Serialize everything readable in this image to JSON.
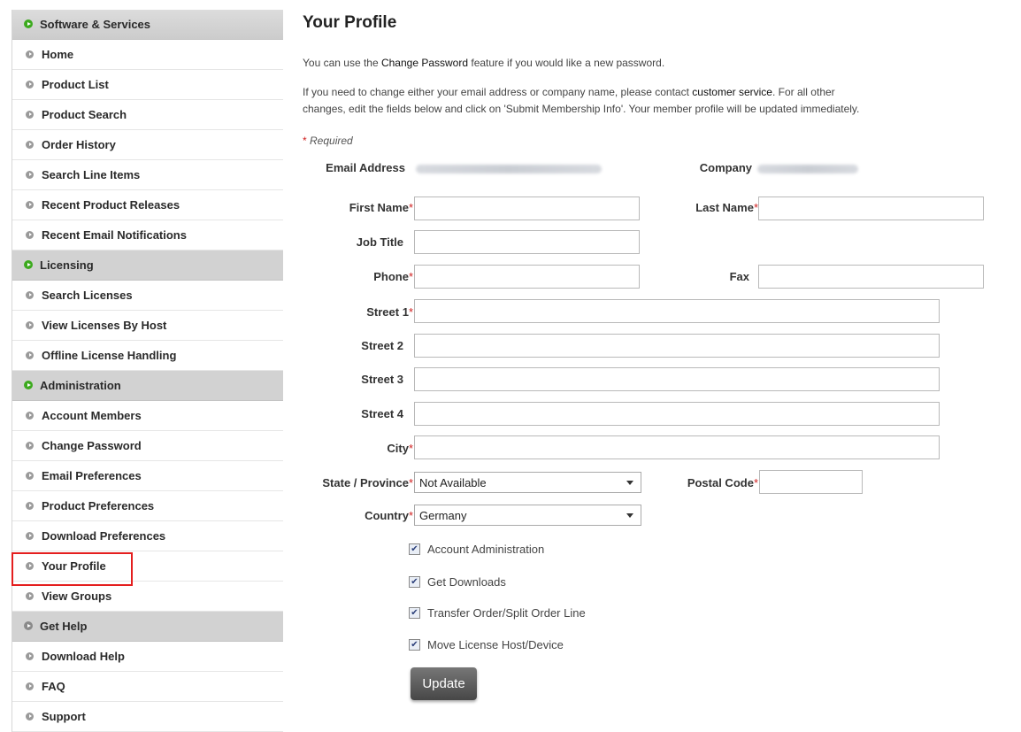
{
  "sidebar": {
    "sections": [
      {
        "title": "Software & Services",
        "items": [
          "Home",
          "Product List",
          "Product Search",
          "Order History",
          "Search Line Items",
          "Recent Product Releases",
          "Recent Email Notifications"
        ]
      },
      {
        "title": "Licensing",
        "items": [
          "Search Licenses",
          "View Licenses By Host",
          "Offline License Handling"
        ]
      },
      {
        "title": "Administration",
        "items": [
          "Account Members",
          "Change Password",
          "Email Preferences",
          "Product Preferences",
          "Download Preferences",
          "Your Profile",
          "View Groups"
        ]
      },
      {
        "title": "Get Help",
        "items": [
          "Download Help",
          "FAQ",
          "Support"
        ]
      }
    ],
    "active_item": "Your Profile",
    "colors": {
      "section_bullet_active": "#3caa1e",
      "highlight_border": "#e41e1e"
    }
  },
  "main": {
    "title": "Your Profile",
    "intro1": {
      "pre": "You can use the ",
      "link": "Change Password",
      "post": " feature if you would like a new password."
    },
    "intro2": {
      "pre": "If you need to change either your email address or company name, please contact ",
      "link": "customer service",
      "post": ". For all other"
    },
    "intro3": "changes, edit the fields below and click on 'Submit Membership Info'. Your member profile will be updated immediately.",
    "required_note": {
      "star": "*",
      "text": " Required"
    },
    "email_label": "Email Address",
    "company_label": "Company",
    "labels": {
      "first_name": "First Name",
      "last_name": "Last Name",
      "job_title": "Job Title",
      "phone": "Phone",
      "fax": "Fax",
      "street1": "Street 1",
      "street2": "Street 2",
      "street3": "Street 3",
      "street4": "Street 4",
      "city": "City",
      "state": "State / Province",
      "postal": "Postal Code",
      "country": "Country"
    },
    "required_star": "*",
    "state_value": "Not Available",
    "country_value": "Germany",
    "checkboxes": [
      "Account Administration",
      "Get Downloads",
      "Transfer Order/Split Order Line",
      "Move License Host/Device"
    ],
    "check_glyph": "✔",
    "update_label": "Update"
  }
}
